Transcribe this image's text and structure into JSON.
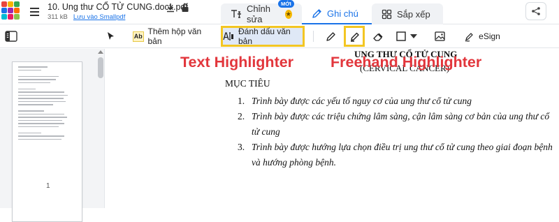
{
  "app": {
    "logo_colors": [
      "#e8453c",
      "#f7b500",
      "#34a853",
      "#1a73e8",
      "#9c27b0",
      "#ff6d00",
      "#00bcd4",
      "#e91e63",
      "#8bc34a"
    ]
  },
  "file": {
    "name": "10. Ung thư CỔ TỬ CUNG.docx.pdf",
    "size": "311 kB",
    "save_link": "Lưu vào Smallpdf"
  },
  "tabs": [
    {
      "label": "Chỉnh sửa",
      "icon": "text-cursor-icon",
      "badge": "MỚI",
      "active": false
    },
    {
      "label": "Ghi chú",
      "icon": "pencil-icon",
      "active": true
    },
    {
      "label": "Sắp xếp",
      "icon": "grid-icon",
      "active": false
    }
  ],
  "toolbar": {
    "add_text_label": "Thêm hộp văn bản",
    "add_text_icon_text": "Ab",
    "highlight_text_label": "Đánh dấu văn bản",
    "esign_label": "eSign",
    "highlight_box_color": "#f3c623"
  },
  "thumbnails": {
    "page_number": "1"
  },
  "document": {
    "title": "UNG THƯ CỔ TỬ CUNG",
    "subtitle": "(CERVICAL CANCER)",
    "heading": "MỤC TIÊU",
    "objectives": [
      {
        "num": "1.",
        "text": "Trình bày được các yếu tố nguy cơ của ung thư cổ tử cung"
      },
      {
        "num": "2.",
        "text": "Trình bày được các triệu chứng lâm sàng, cận lâm sàng cơ bản của ung thư cổ tử cung"
      },
      {
        "num": "3.",
        "text": "Trình bày được hướng lựa chọn điều trị ung thư cổ tử cung theo giai đoạn bệnh và hướng phòng bệnh."
      }
    ]
  },
  "annotations": {
    "text_highlighter": "Text Highlighter",
    "freehand_highlighter": "Freehand Highlighter",
    "color": "#e2363c"
  }
}
